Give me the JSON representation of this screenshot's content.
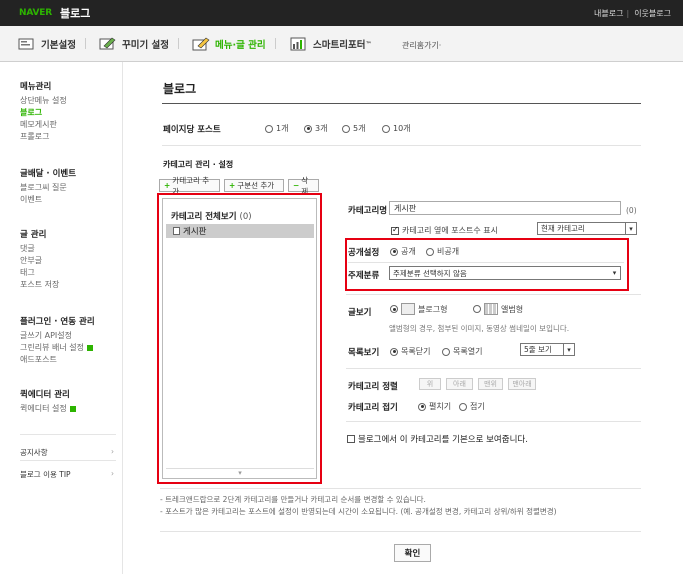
{
  "app": {
    "brand": "NAVER",
    "product": "블로그"
  },
  "toplinks": {
    "my_blog": "내블로그",
    "neighbor_blog": "이웃블로그"
  },
  "tabs": [
    {
      "label": "기본설정",
      "icon": "basic-settings-icon"
    },
    {
      "label": "꾸미기 설정",
      "icon": "decorate-icon"
    },
    {
      "label": "메뉴·글 관리",
      "icon": "menu-post-icon",
      "active": true
    },
    {
      "label": "스마트리포터",
      "superscript": "™",
      "icon": "smart-reporter-icon"
    }
  ],
  "tab_more": "관리홈가기·",
  "sidebar": {
    "groups": [
      {
        "title": "메뉴관리",
        "items": [
          {
            "label": "상단메뉴 설정"
          },
          {
            "label": "블로그",
            "active": true
          },
          {
            "label": "메모게시판"
          },
          {
            "label": "프롤로그"
          }
        ]
      },
      {
        "title": "글배달 · 이벤트",
        "items": [
          {
            "label": "블로그씨 질문"
          },
          {
            "label": "이벤트"
          }
        ]
      },
      {
        "title": "글 관리",
        "items": [
          {
            "label": "댓글"
          },
          {
            "label": "안부글"
          },
          {
            "label": "태그"
          },
          {
            "label": "포스트 저장"
          }
        ]
      },
      {
        "title": "플러그인 · 연동 관리",
        "items": [
          {
            "label": "글쓰기 API설정"
          },
          {
            "label": "그린리뷰 배너 설정",
            "new": true
          },
          {
            "label": "애드포스트"
          }
        ]
      },
      {
        "title": "퀵에디터 관리",
        "items": [
          {
            "label": "퀵에디터 설정",
            "new": true
          }
        ]
      }
    ],
    "footer": [
      {
        "label": "공지사항"
      },
      {
        "label": "블로그 이용 TIP"
      }
    ]
  },
  "main": {
    "title": "블로그",
    "posts_per_page": {
      "label": "페이지당 포스트",
      "options": [
        "1개",
        "3개",
        "5개",
        "10개"
      ],
      "selected": "3개"
    },
    "category_section_title": "카테고리 관리 · 설정",
    "buttons": {
      "add_category": "카테고리 추가",
      "add_separator": "구분선 추가",
      "delete": "삭제"
    },
    "category_tree": {
      "header": "카테고리 전체보기",
      "count": "(0)",
      "items": [
        {
          "label": "게시판",
          "selected": true
        }
      ]
    },
    "form": {
      "category_name": {
        "label": "카테고리명",
        "value": "게시판",
        "count": "(0)"
      },
      "show_count": {
        "label": "카테고리 옆에 포스트수 표시",
        "checked": true,
        "select": "현재 카테고리"
      },
      "public": {
        "label": "공개설정",
        "options": [
          "공개",
          "비공개"
        ],
        "selected": "공개"
      },
      "topic": {
        "label": "주제분류",
        "select": "주제분류 선택하지 않음"
      },
      "view_mode": {
        "label": "글보기",
        "options": [
          "블로그형",
          "앨범형"
        ],
        "selected": "블로그형",
        "note": "앨범형의 경우, 첨부된 이미지, 동영상 썸네일이 보입니다."
      },
      "list_view": {
        "label": "목록보기",
        "options": [
          "목록닫기",
          "목록열기"
        ],
        "selected": "목록닫기",
        "select": "5줄 보기"
      },
      "sort": {
        "label": "카테고리 정렬",
        "buttons": [
          "위",
          "아래",
          "맨위",
          "맨아래"
        ]
      },
      "fold": {
        "label": "카테고리 접기",
        "options": [
          "펼치기",
          "접기"
        ],
        "selected": "펼치기"
      },
      "default_view": {
        "label": "블로그에서 이 카테고리를 기본으로 보여줍니다.",
        "checked": false
      }
    },
    "footnotes": [
      "- 트레크앤드랍으로 2단계 카테고리를 만들거나 카테고리 순서를 변경할 수 있습니다.",
      "- 포스트가 많은 카테고리는 포스트에 설정이 반영되는데 시간이 소요됩니다. (예. 공개설정 변경, 카테고리 상위/하위 정렬변경)"
    ],
    "confirm": "확인"
  },
  "colors": {
    "accent": "#2db400",
    "highlight": "#e60012",
    "topbar": "#232323"
  }
}
